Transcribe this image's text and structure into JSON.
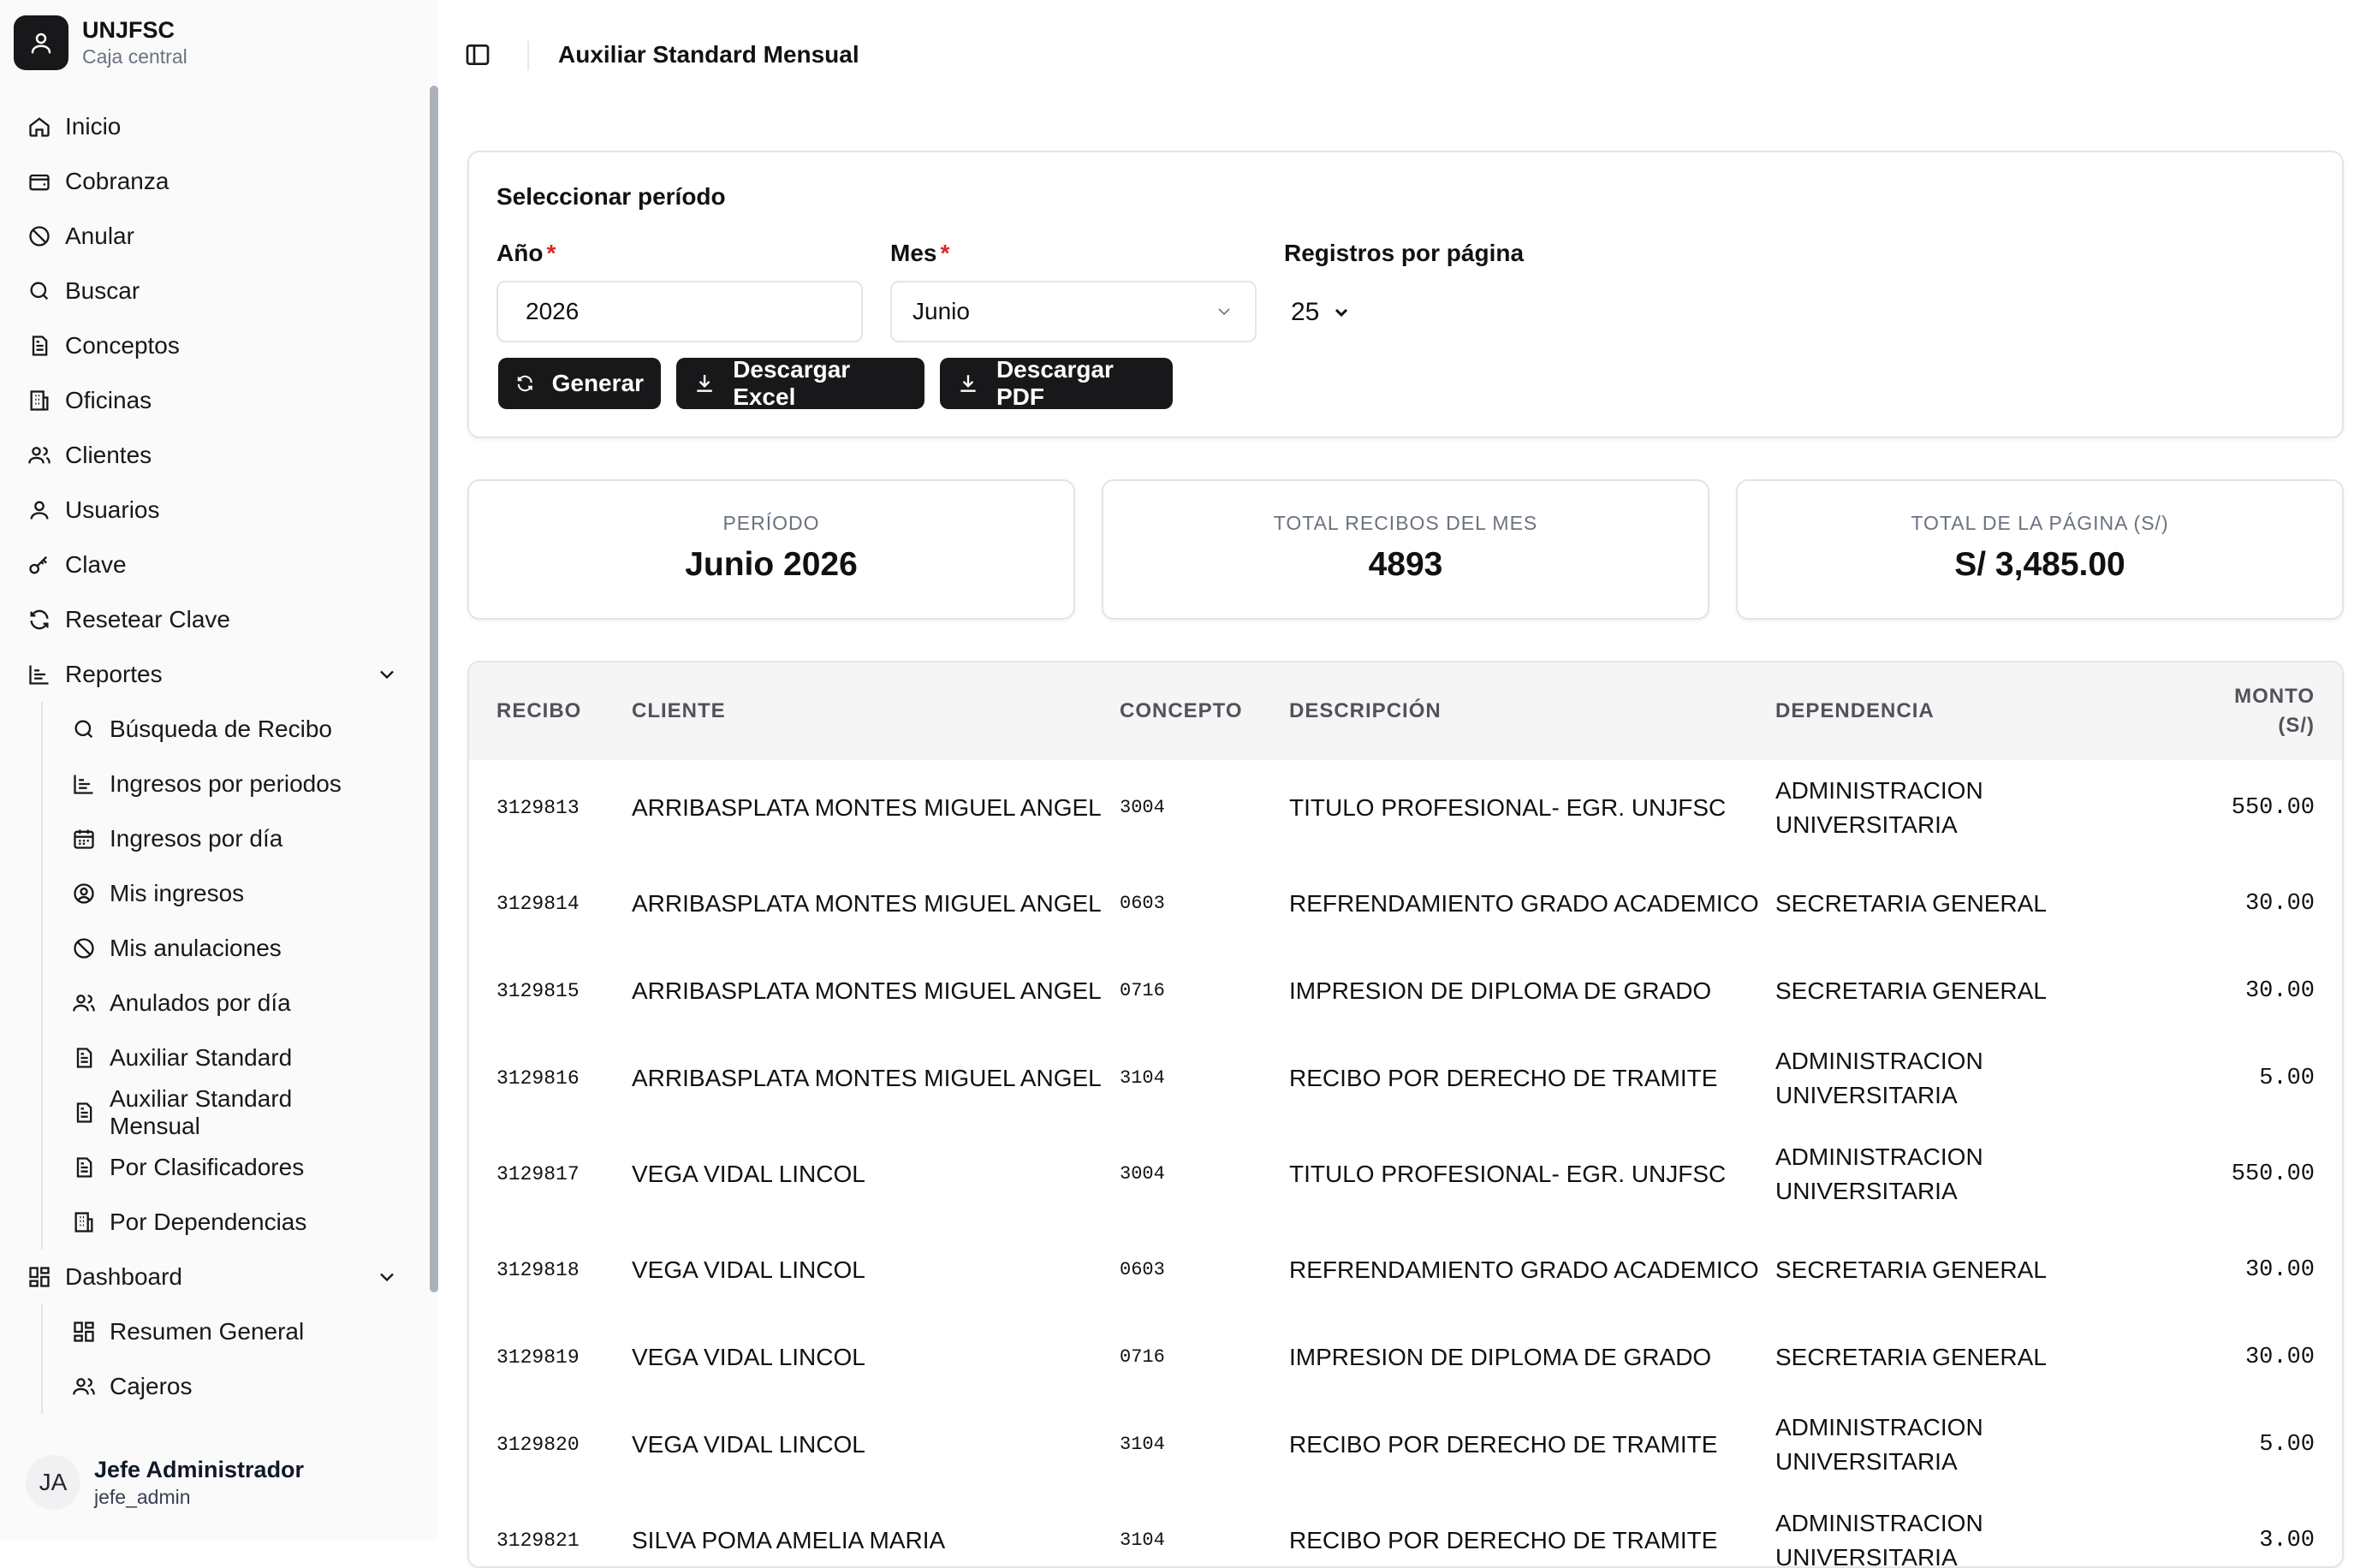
{
  "brand": {
    "name": "UNJFSC",
    "subtitle": "Caja central"
  },
  "nav": {
    "inicio": "Inicio",
    "cobranza": "Cobranza",
    "anular": "Anular",
    "buscar": "Buscar",
    "conceptos": "Conceptos",
    "oficinas": "Oficinas",
    "clientes": "Clientes",
    "usuarios": "Usuarios",
    "clave": "Clave",
    "resetear_clave": "Resetear Clave",
    "reportes": "Reportes",
    "reportes_items": {
      "busqueda_recibo": "Búsqueda de Recibo",
      "ingresos_periodos": "Ingresos por periodos",
      "ingresos_dia": "Ingresos por día",
      "mis_ingresos": "Mis ingresos",
      "mis_anulaciones": "Mis anulaciones",
      "anulados_dia": "Anulados por día",
      "auxiliar_standard": "Auxiliar Standard",
      "auxiliar_standard_mensual": "Auxiliar Standard Mensual",
      "por_clasificadores": "Por Clasificadores",
      "por_dependencias": "Por Dependencias"
    },
    "dashboard": "Dashboard",
    "dashboard_items": {
      "resumen_general": "Resumen General",
      "cajeros": "Cajeros"
    }
  },
  "user": {
    "initials": "JA",
    "name": "Jefe Administrador",
    "login": "jefe_admin"
  },
  "header": {
    "title": "Auxiliar Standard Mensual"
  },
  "filters": {
    "title": "Seleccionar período",
    "year_label": "Año",
    "year_value": "2026",
    "month_label": "Mes",
    "month_value": "Junio",
    "required_mark": "*",
    "per_page_label": "Registros por página",
    "per_page_value": "25",
    "btn_generar": "Generar",
    "btn_excel": "Descargar Excel",
    "btn_pdf": "Descargar PDF"
  },
  "stats": {
    "periodo_label": "PERÍODO",
    "periodo_value": "Junio 2026",
    "recibos_label": "TOTAL RECIBOS DEL MES",
    "recibos_value": "4893",
    "pagina_label": "TOTAL DE LA PÁGINA (S/)",
    "pagina_value": "S/ 3,485.00"
  },
  "table": {
    "headers": {
      "recibo": "RECIBO",
      "cliente": "CLIENTE",
      "concepto": "CONCEPTO",
      "descripcion": "DESCRIPCIÓN",
      "dependencia": "DEPENDENCIA",
      "monto_1": "MONTO",
      "monto_2": "(S/)"
    },
    "rows": [
      {
        "recibo": "3129813",
        "cliente": "ARRIBASPLATA MONTES MIGUEL ANGEL",
        "concepto": "3004",
        "descripcion": "TITULO PROFESIONAL- EGR. UNJFSC",
        "dependencia": "ADMINISTRACION UNIVERSITARIA",
        "monto": "550.00"
      },
      {
        "recibo": "3129814",
        "cliente": "ARRIBASPLATA MONTES MIGUEL ANGEL",
        "concepto": "0603",
        "descripcion": "REFRENDAMIENTO GRADO ACADEMICO",
        "dependencia": "SECRETARIA GENERAL",
        "monto": "30.00"
      },
      {
        "recibo": "3129815",
        "cliente": "ARRIBASPLATA MONTES MIGUEL ANGEL",
        "concepto": "0716",
        "descripcion": "IMPRESION DE DIPLOMA DE GRADO",
        "dependencia": "SECRETARIA GENERAL",
        "monto": "30.00"
      },
      {
        "recibo": "3129816",
        "cliente": "ARRIBASPLATA MONTES MIGUEL ANGEL",
        "concepto": "3104",
        "descripcion": "RECIBO POR DERECHO DE TRAMITE",
        "dependencia": "ADMINISTRACION UNIVERSITARIA",
        "monto": "5.00"
      },
      {
        "recibo": "3129817",
        "cliente": "VEGA VIDAL LINCOL",
        "concepto": "3004",
        "descripcion": "TITULO PROFESIONAL- EGR. UNJFSC",
        "dependencia": "ADMINISTRACION UNIVERSITARIA",
        "monto": "550.00"
      },
      {
        "recibo": "3129818",
        "cliente": "VEGA VIDAL LINCOL",
        "concepto": "0603",
        "descripcion": "REFRENDAMIENTO GRADO ACADEMICO",
        "dependencia": "SECRETARIA GENERAL",
        "monto": "30.00"
      },
      {
        "recibo": "3129819",
        "cliente": "VEGA VIDAL LINCOL",
        "concepto": "0716",
        "descripcion": "IMPRESION DE DIPLOMA DE GRADO",
        "dependencia": "SECRETARIA GENERAL",
        "monto": "30.00"
      },
      {
        "recibo": "3129820",
        "cliente": "VEGA VIDAL LINCOL",
        "concepto": "3104",
        "descripcion": "RECIBO POR DERECHO DE TRAMITE",
        "dependencia": "ADMINISTRACION UNIVERSITARIA",
        "monto": "5.00"
      },
      {
        "recibo": "3129821",
        "cliente": "SILVA POMA AMELIA MARIA",
        "concepto": "3104",
        "descripcion": "RECIBO POR DERECHO DE TRAMITE",
        "dependencia": "ADMINISTRACION UNIVERSITARIA",
        "monto": "3.00"
      }
    ]
  }
}
